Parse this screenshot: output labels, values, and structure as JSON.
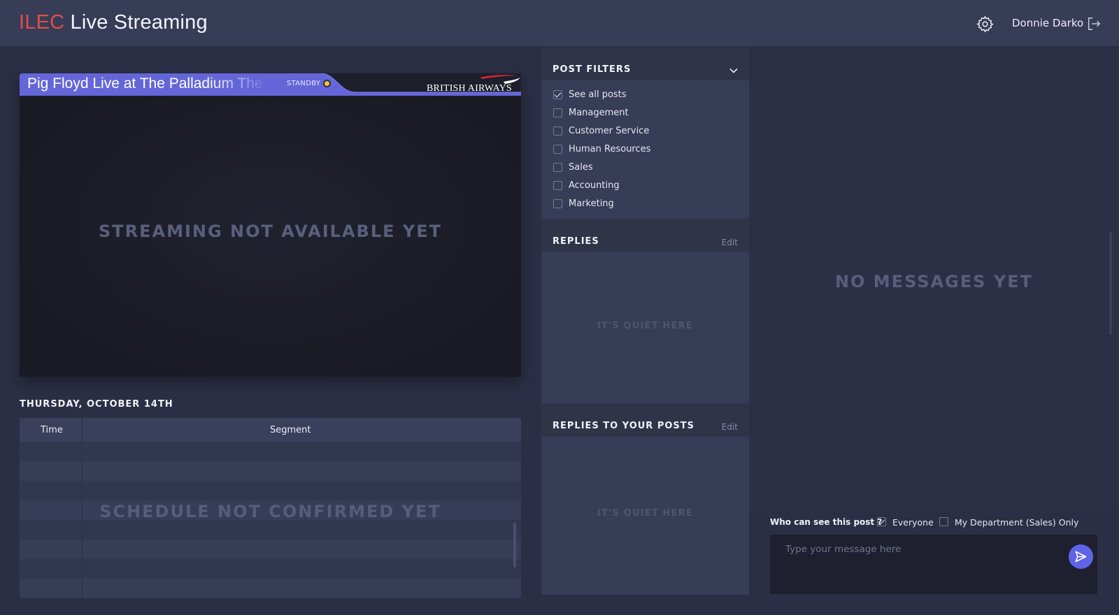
{
  "header": {
    "brand_accent": "ILEC",
    "brand_rest": " Live Streaming",
    "user_name": "Donnie Darko",
    "icons": [
      "gear-icon",
      "logout-icon"
    ]
  },
  "stream": {
    "title": "Pig Floyd Live at The Palladium The",
    "status": "STANDBY",
    "sponsor": "BRITISH AIRWAYS",
    "message": "STREAMING NOT AVAILABLE YET"
  },
  "schedule": {
    "date": "THURSDAY, OCTOBER 14TH",
    "columns": [
      "Time",
      "Segment"
    ],
    "message": "SCHEDULE NOT CONFIRMED YET"
  },
  "filters": {
    "title": "POST FILTERS",
    "items": [
      {
        "label": "See all posts",
        "checked": true
      },
      {
        "label": "Management",
        "checked": false
      },
      {
        "label": "Customer Service",
        "checked": false
      },
      {
        "label": "Human Resources",
        "checked": false
      },
      {
        "label": "Sales",
        "checked": false
      },
      {
        "label": "Accounting",
        "checked": false
      },
      {
        "label": "Marketing",
        "checked": false
      }
    ]
  },
  "replies": {
    "title": "REPLIES",
    "edit": "Edit",
    "empty": "IT'S QUIET HERE"
  },
  "replies_to_posts": {
    "title": "REPLIES TO YOUR POSTS",
    "edit": "Edit",
    "empty": "IT'S QUIET HERE"
  },
  "messages": {
    "empty": "NO MESSAGES YET"
  },
  "compose": {
    "visibility_label": "Who can see this post ?",
    "options": [
      {
        "label": "Everyone",
        "checked": true
      },
      {
        "label": "My Department (Sales) Only",
        "checked": false
      }
    ],
    "placeholder": "Type your message here"
  },
  "colors": {
    "brand_accent": "#e04e4a",
    "stream_bar": "#6466d8",
    "send_button": "#5f63e6",
    "standby_dot": "#f1c232"
  }
}
